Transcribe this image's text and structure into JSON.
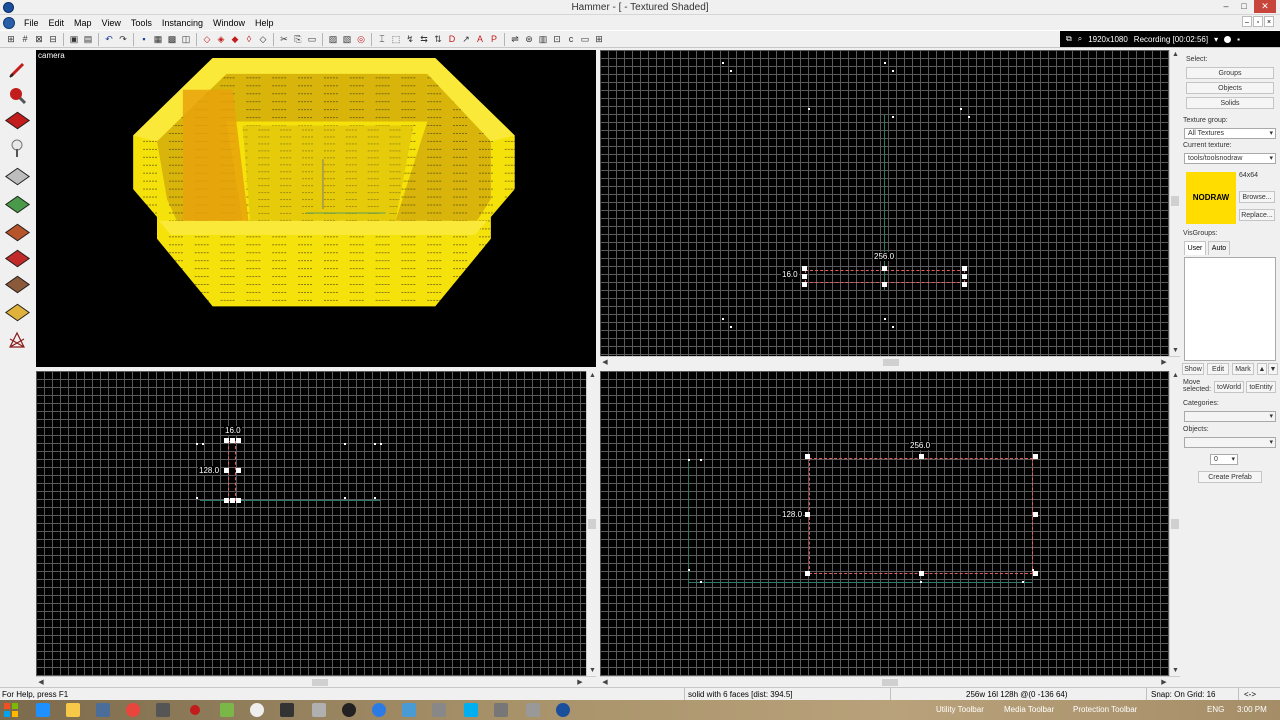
{
  "window": {
    "title": "Hammer - [ - Textured Shaded]",
    "controls": [
      "–",
      "□",
      "✕"
    ]
  },
  "menu": {
    "items": [
      "File",
      "Edit",
      "Map",
      "View",
      "Tools",
      "Instancing",
      "Window",
      "Help"
    ]
  },
  "recording": {
    "resolution": "1920x1080",
    "status": "Recording [00:02:56]"
  },
  "viewports": {
    "camera": {
      "label": "camera"
    },
    "top": {
      "width_label": "256.0",
      "height_label": "16.0"
    },
    "front": {
      "width_label": "16.0",
      "height_label": "128.0"
    },
    "side": {
      "width_label": "256.0",
      "height_label": "128.0"
    }
  },
  "right_panel": {
    "select_label": "Select:",
    "groups_btn": "Groups",
    "objects_btn": "Objects",
    "solids_btn": "Solids",
    "texture_group_label": "Texture group:",
    "texture_group_value": "All Textures",
    "current_texture_label": "Current texture:",
    "current_texture_value": "tools/toolsnodraw",
    "texture_size": "64x64",
    "texture_name": "NODRAW",
    "browse_btn": "Browse...",
    "replace_btn": "Replace...",
    "visgroups_label": "VisGroups:",
    "tab_user": "User",
    "tab_auto": "Auto",
    "show_btn": "Show",
    "edit_btn": "Edit",
    "mark_btn": "Mark",
    "move_selected_label": "Move selected:",
    "to_world_btn": "toWorld",
    "to_entity_btn": "toEntity",
    "categories_label": "Categories:",
    "objects_label": "Objects:",
    "stepper_value": "0",
    "create_prefab_btn": "Create Prefab"
  },
  "status": {
    "help": "For Help, press F1",
    "selection": "solid with 6 faces  [dist: 394.5]",
    "size": "256w 16l 128h @(0 -136 64)",
    "snap": "Snap: On Grid: 16",
    "extra": "<->"
  },
  "taskbar": {
    "utility": "Utility Toolbar",
    "media": "Media Toolbar",
    "protection": "Protection Toolbar",
    "lang": "ENG",
    "time": "3:00 PM"
  },
  "colors": {
    "viewport_bg": "#000000",
    "grid_line": "#5a5a5a",
    "selection_dash": "#e06060",
    "texture_yellow": "#ffdd00"
  }
}
